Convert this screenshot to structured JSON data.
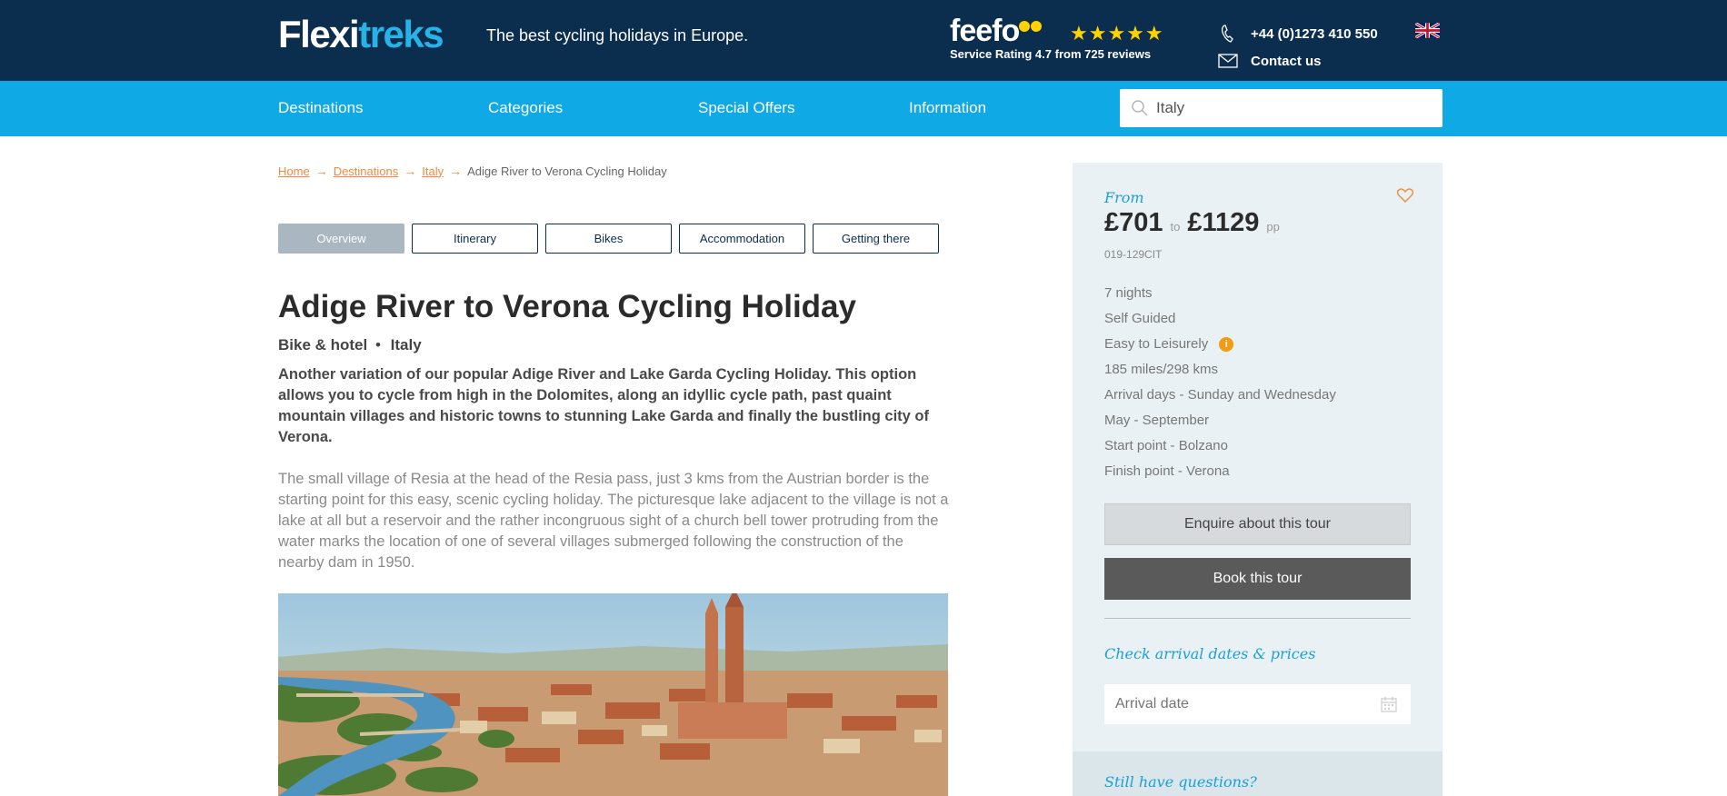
{
  "header": {
    "logo_part1": "Flexi",
    "logo_part2": "treks",
    "tagline": "The best cycling holidays in Europe.",
    "feefo_word": "feefo",
    "feefo_stars": "★★★★★",
    "feefo_rating": "Service Rating 4.7 from 725 reviews",
    "phone": "+44 (0)1273 410 550",
    "contact": "Contact us",
    "flag_icon": "uk-flag-icon"
  },
  "nav": {
    "items": [
      "Destinations",
      "Categories",
      "Special Offers",
      "Information"
    ],
    "search_value": "Italy"
  },
  "breadcrumb": {
    "items": [
      "Home",
      "Destinations",
      "Italy"
    ],
    "current": "Adige River to Verona Cycling Holiday"
  },
  "tabs": [
    "Overview",
    "Itinerary",
    "Bikes",
    "Accommodation",
    "Getting there"
  ],
  "main": {
    "title": "Adige River to Verona Cycling Holiday",
    "category": "Bike & hotel",
    "separator": "•",
    "country": "Italy",
    "intro": "Another variation of our popular Adige River and Lake Garda Cycling Holiday. This option allows you to cycle from high in the Dolomites, along an idyllic cycle path, past quaint mountain villages and historic towns to stunning Lake Garda and finally the bustling city of Verona.",
    "body": "The small village of Resia at the head of the Resia pass, just 3 kms from the Austrian border is the starting point for this easy, scenic cycling holiday. The picturesque lake adjacent to the village is not a lake at all but a reservoir and the rather incongruous sight of a church bell tower protruding from the water marks the location of one of several villages submerged following the construction of the nearby dam in 1950."
  },
  "sidebar": {
    "from_label": "From",
    "price_from": "£701",
    "to_label": "to",
    "price_to": "£1129",
    "pp_label": "pp",
    "code": "019-129CIT",
    "facts": [
      "7 nights",
      "Self Guided",
      "Easy to Leisurely",
      "185 miles/298 kms",
      "Arrival days - Sunday and Wednesday",
      "May - September",
      "Start point - Bolzano",
      "Finish point - Verona"
    ],
    "info_icon_text": "i",
    "enquire_button": "Enquire about this tour",
    "book_button": "Book this tour",
    "check_dates": "Check arrival dates & prices",
    "arrival_placeholder": "Arrival date",
    "questions": "Still have questions?"
  },
  "colors": {
    "header_bg": "#0b2e4e",
    "nav_bg": "#0fa9e6",
    "accent_orange": "#f08a3c",
    "accent_blue": "#1a9fd8"
  }
}
